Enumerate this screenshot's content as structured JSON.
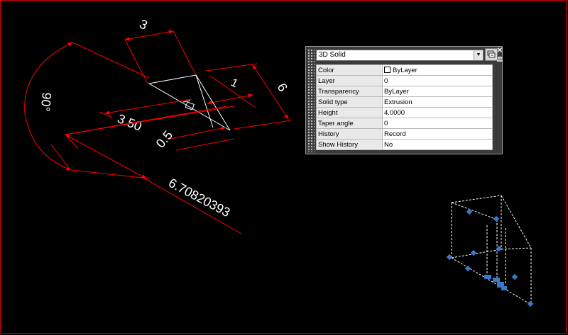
{
  "drawing": {
    "dimensions": {
      "angle": "90°",
      "width_top": "3",
      "small_dim": "1",
      "side_dim": "6",
      "dim_350": "3.50",
      "dim_05": "0.5",
      "long_dim": "6.70820393"
    },
    "colors": {
      "dimension": "#ff0000",
      "geometry": "#ffffff",
      "grip": "#3a78c8",
      "background": "#000000"
    }
  },
  "quick_properties": {
    "selection": "3D Solid",
    "select_objects_icon": "select-objects-icon",
    "rows": [
      {
        "name": "Color",
        "value": "ByLayer",
        "swatch": true
      },
      {
        "name": "Layer",
        "value": "0"
      },
      {
        "name": "Transparency",
        "value": "ByLayer"
      },
      {
        "name": "Solid type",
        "value": "Extrusion"
      },
      {
        "name": "Height",
        "value": "4.0000"
      },
      {
        "name": "Taper angle",
        "value": "0"
      },
      {
        "name": "History",
        "value": "Record"
      },
      {
        "name": "Show History",
        "value": "No"
      }
    ]
  }
}
